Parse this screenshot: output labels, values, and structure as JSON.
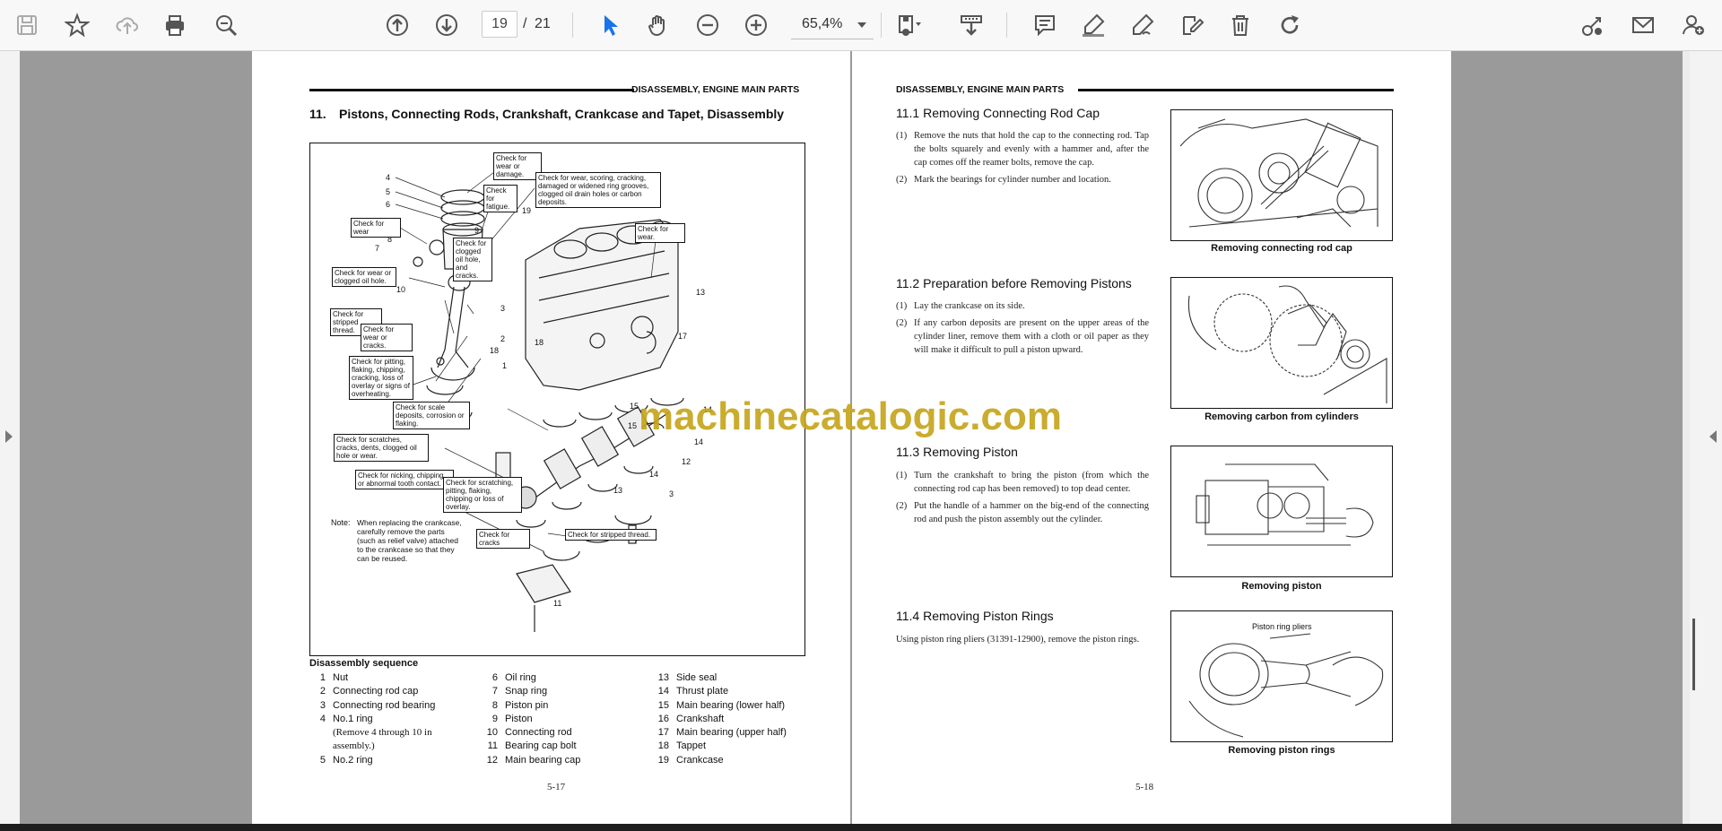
{
  "toolbar": {
    "page_current": "19",
    "page_sep": "/",
    "page_total": "21",
    "zoom": "65,4%",
    "icons": [
      "save-icon",
      "star-icon",
      "upload-cloud-icon",
      "print-icon",
      "zoom-out-search-icon",
      "arrow-up-circle-icon",
      "arrow-down-circle-icon",
      "select-cursor-icon",
      "hand-tool-icon",
      "zoom-out-icon",
      "zoom-in-icon",
      "page-fit-icon",
      "download-tray-icon",
      "comment-icon",
      "highlighter-icon",
      "pen-icon",
      "signature-icon",
      "delete-icon",
      "rotate-icon",
      "share-link-icon",
      "email-icon",
      "add-user-icon"
    ],
    "accent": "#1a73e8"
  },
  "left_page": {
    "running_head": "DISASSEMBLY, ENGINE MAIN PARTS",
    "heading_num": "11.",
    "heading": "Pistons, Connecting Rods, Crankshaft, Crankcase and Tapet, Disassembly",
    "callouts": [
      "Check for wear or damage.",
      "Check for wear, scoring, cracking, damaged or widened ring grooves, clogged oil drain holes or carbon deposits.",
      "Check for fatigue.",
      "Check for wear",
      "Check for clogged oil hole, and cracks.",
      "Check for wear.",
      "Check for wear or clogged oil hole.",
      "Check for stripped thread.",
      "Check for wear or cracks.",
      "Check for pitting, flaking, chipping, cracking, loss of overlay or signs of overheating.",
      "Check for scale deposits, corrosion or flaking.",
      "Check for scratches, cracks, dents, clogged oil hole or wear.",
      "Check for nicking, chipping, or abnormal tooth contact.",
      "Check for scratching, pitting, flaking, chipping or loss of overlay.",
      "Check for cracks",
      "Check for stripped thread."
    ],
    "part_numbers": [
      "1",
      "2",
      "3",
      "4",
      "5",
      "6",
      "7",
      "8",
      "9",
      "10",
      "11",
      "12",
      "13",
      "14",
      "14",
      "15",
      "17",
      "18",
      "19"
    ],
    "note_label": "Note:",
    "note_text": "When replacing the crankcase, carefully remove the parts (such as relief valve) attached to the crankcase so that they can be reused.",
    "sequence_title": "Disassembly sequence",
    "sequence_col1": [
      {
        "n": "1",
        "t": "Nut"
      },
      {
        "n": "2",
        "t": "Connecting rod cap"
      },
      {
        "n": "3",
        "t": "Connecting rod bearing"
      },
      {
        "n": "4",
        "t": "No.1 ring"
      },
      {
        "n": "",
        "t": "(Remove 4 through 10 in"
      },
      {
        "n": "",
        "t": "assembly.)"
      },
      {
        "n": "5",
        "t": "No.2 ring"
      }
    ],
    "sequence_col2": [
      {
        "n": "6",
        "t": "Oil ring"
      },
      {
        "n": "7",
        "t": "Snap ring"
      },
      {
        "n": "8",
        "t": "Piston pin"
      },
      {
        "n": "9",
        "t": "Piston"
      },
      {
        "n": "10",
        "t": "Connecting rod"
      },
      {
        "n": "11",
        "t": "Bearing cap bolt"
      },
      {
        "n": "12",
        "t": "Main bearing cap"
      }
    ],
    "sequence_col3": [
      {
        "n": "13",
        "t": "Side seal"
      },
      {
        "n": "14",
        "t": "Thrust plate"
      },
      {
        "n": "15",
        "t": "Main bearing (lower half)"
      },
      {
        "n": "16",
        "t": "Crankshaft"
      },
      {
        "n": "17",
        "t": "Main bearing (upper half)"
      },
      {
        "n": "18",
        "t": "Tappet"
      },
      {
        "n": "19",
        "t": "Crankcase"
      }
    ],
    "page_number": "5-17"
  },
  "right_page": {
    "running_head": "DISASSEMBLY, ENGINE MAIN PARTS",
    "sections": [
      {
        "title": "11.1 Removing Connecting Rod Cap",
        "items": [
          {
            "mk": "(1)",
            "t": "Remove the nuts that hold the cap to the connecting rod. Tap the bolts squarely and evenly with a hammer and, after the cap comes off the reamer bolts, remove the cap."
          },
          {
            "mk": "(2)",
            "t": "Mark the bearings for cylinder number and location."
          }
        ],
        "caption": "Removing connecting rod cap"
      },
      {
        "title": "11.2 Preparation before Removing Pistons",
        "items": [
          {
            "mk": "(1)",
            "t": "Lay the crankcase on its side."
          },
          {
            "mk": "(2)",
            "t": "If any carbon deposits are present on the upper areas of the cylinder liner, remove them with a cloth or oil paper as they will make it difficult to pull a piston upward."
          }
        ],
        "caption": "Removing carbon from cylinders"
      },
      {
        "title": "11.3 Removing Piston",
        "items": [
          {
            "mk": "(1)",
            "t": "Turn the crankshaft to bring the piston (from which the connecting rod cap has been removed) to top dead center."
          },
          {
            "mk": "(2)",
            "t": "Put the handle of a hammer on the big-end of the connecting rod and push the piston assembly out the cylinder."
          }
        ],
        "caption": "Removing piston"
      },
      {
        "title": "11.4 Removing Piston Rings",
        "body": "Using piston ring pliers (31391-12900), remove the piston rings.",
        "photo_label": "Piston ring pliers",
        "caption": "Removing piston rings"
      }
    ],
    "page_number": "5-18"
  },
  "watermark": "machinecatalogic.com"
}
